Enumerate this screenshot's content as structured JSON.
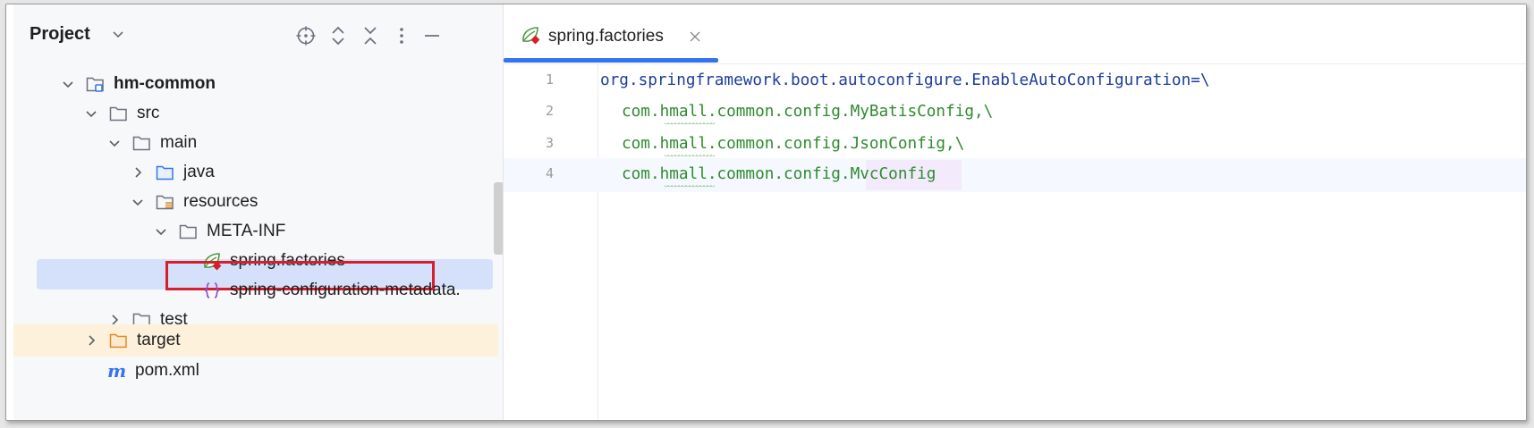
{
  "project_panel": {
    "title": "Project",
    "header_icons": [
      "crosshair-icon",
      "expand-all-icon",
      "collapse-all-icon",
      "more-vert-icon",
      "minimize-icon"
    ],
    "tree": [
      {
        "label": "hm-common",
        "icon": "module-folder-icon",
        "expanded": true
      },
      {
        "label": "src",
        "icon": "folder-icon",
        "expanded": true
      },
      {
        "label": "main",
        "icon": "folder-icon",
        "expanded": true
      },
      {
        "label": "java",
        "icon": "source-folder-icon",
        "expanded": false
      },
      {
        "label": "resources",
        "icon": "resources-folder-icon",
        "expanded": true
      },
      {
        "label": "META-INF",
        "icon": "folder-icon",
        "expanded": true
      },
      {
        "label": "spring.factories",
        "icon": "spring-leaf-icon",
        "selected": true
      },
      {
        "label": "spring-configuration-metadata.",
        "icon": "json-braces-icon"
      },
      {
        "label": "test",
        "icon": "folder-icon",
        "expanded": false
      },
      {
        "label": "target",
        "icon": "excluded-folder-icon",
        "expanded": false
      },
      {
        "label": "pom.xml",
        "icon": "maven-icon"
      }
    ]
  },
  "editor": {
    "tab": {
      "label": "spring.factories",
      "icon": "spring-leaf-icon"
    },
    "lines": [
      {
        "number": "1",
        "text": "org.springframework.boot.autoconfigure.EnableAutoConfiguration=\\"
      },
      {
        "number": "2",
        "text": "com.hmall.common.config.MyBatisConfig,\\"
      },
      {
        "number": "3",
        "text": "com.hmall.common.config.JsonConfig,\\"
      },
      {
        "number": "4",
        "text": "com.hmall.common.config.MvcConfig"
      }
    ]
  },
  "colors": {
    "accent": "#3574f0",
    "selection": "#d5e1fb",
    "highlight_box": "#d61f2b",
    "code_key": "#1c3d9e",
    "code_value": "#2e8b2e"
  }
}
